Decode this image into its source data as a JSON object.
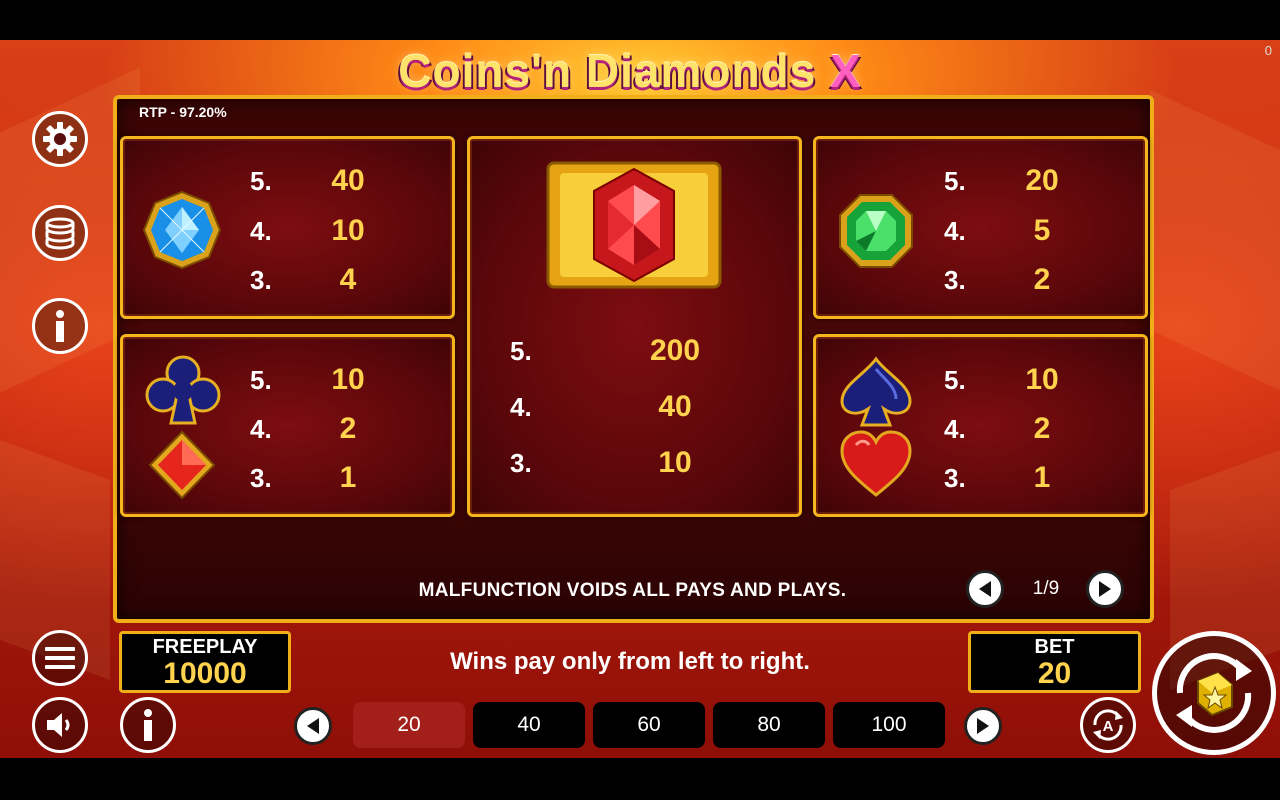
{
  "game": {
    "title_main": "Coins'n Diamonds",
    "title_x": "X",
    "corner_counter": "0"
  },
  "rtp": "RTP - 97.20%",
  "paytable": {
    "blue_diamond": {
      "rows": [
        {
          "k": "5.",
          "v": "40"
        },
        {
          "k": "4.",
          "v": "10"
        },
        {
          "k": "3.",
          "v": "4"
        }
      ]
    },
    "red_diamond": {
      "rows": [
        {
          "k": "5.",
          "v": "200"
        },
        {
          "k": "4.",
          "v": "40"
        },
        {
          "k": "3.",
          "v": "10"
        }
      ]
    },
    "green_emerald": {
      "rows": [
        {
          "k": "5.",
          "v": "20"
        },
        {
          "k": "4.",
          "v": "5"
        },
        {
          "k": "3.",
          "v": "2"
        }
      ]
    },
    "club_diamond": {
      "rows": [
        {
          "k": "5.",
          "v": "10"
        },
        {
          "k": "4.",
          "v": "2"
        },
        {
          "k": "3.",
          "v": "1"
        }
      ]
    },
    "spade_heart": {
      "rows": [
        {
          "k": "5.",
          "v": "10"
        },
        {
          "k": "4.",
          "v": "2"
        },
        {
          "k": "3.",
          "v": "1"
        }
      ]
    }
  },
  "notice": "MALFUNCTION VOIDS ALL PAYS AND PLAYS.",
  "pager": {
    "label": "1/9"
  },
  "freeplay": {
    "label": "FREEPLAY",
    "value": "10000"
  },
  "bet": {
    "label": "BET",
    "value": "20"
  },
  "wins_text": "Wins pay only from left to right.",
  "bet_options": [
    {
      "label": "20",
      "active": true
    },
    {
      "label": "40",
      "active": false
    },
    {
      "label": "60",
      "active": false
    },
    {
      "label": "80",
      "active": false
    },
    {
      "label": "100",
      "active": false
    }
  ],
  "icons": {
    "side": [
      "gear-icon",
      "coin-stack-icon",
      "info-icon"
    ],
    "bottom": [
      "menu-icon",
      "speaker-icon",
      "info-icon",
      "autoplay-icon",
      "spin-icon"
    ]
  },
  "colors": {
    "gold": "#f4b51e",
    "value_yellow": "#ffd34d",
    "panel_red": "#7d0d10",
    "active_bet": "#a3201a"
  }
}
